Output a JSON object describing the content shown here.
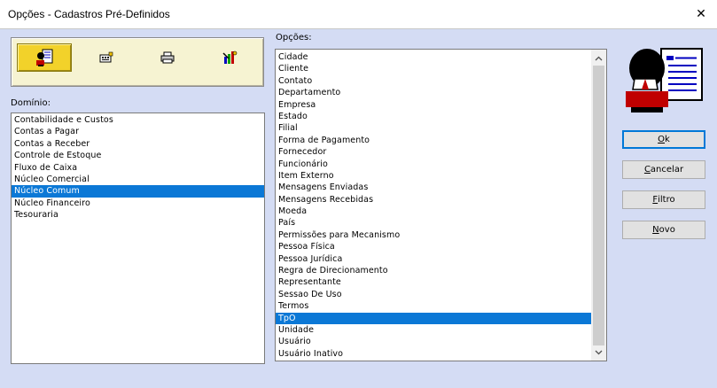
{
  "window": {
    "title": "Opções - Cadastros Pré-Definidos",
    "close_label": "✕"
  },
  "toolbar": {
    "buttons": [
      {
        "name": "person-document-icon",
        "active": true
      },
      {
        "name": "register-icon",
        "active": false
      },
      {
        "name": "printer-icon",
        "active": false
      },
      {
        "name": "tools-icon",
        "active": false
      }
    ]
  },
  "dominio": {
    "label": "Domínio:",
    "items": [
      "Contabilidade e Custos",
      "Contas a Pagar",
      "Contas a Receber",
      "Controle de Estoque",
      "Fluxo de Caixa",
      "Núcleo Comercial",
      "Núcleo Comum",
      "Núcleo Financeiro",
      "Tesouraria"
    ],
    "selected": "Núcleo Comum"
  },
  "opcoes": {
    "label": "Opções:",
    "items": [
      "Cidade",
      "Cliente",
      "Contato",
      "Departamento",
      "Empresa",
      "Estado",
      "Filial",
      "Forma de Pagamento",
      "Fornecedor",
      "Funcionário",
      "Item Externo",
      "Mensagens Enviadas",
      "Mensagens Recebidas",
      "Moeda",
      "País",
      "Permissões para Mecanismo",
      "Pessoa Física",
      "Pessoa Jurídica",
      "Regra de Direcionamento",
      "Representante",
      "Sessao De Uso",
      "Termos",
      "TpO",
      "Unidade",
      "Usuário",
      "Usuário Inativo"
    ],
    "selected": "TpO"
  },
  "buttons": {
    "ok": {
      "accel": "O",
      "rest": "k"
    },
    "cancelar": {
      "accel": "C",
      "rest": "ancelar"
    },
    "filtro": {
      "accel": "F",
      "rest": "iltro"
    },
    "novo": {
      "accel": "N",
      "rest": "ovo"
    }
  },
  "colors": {
    "background": "#d4dcf4",
    "selection": "#0b78d6",
    "toolbar": "#f6f3d2",
    "toolbar_active": "#f2d22a"
  }
}
